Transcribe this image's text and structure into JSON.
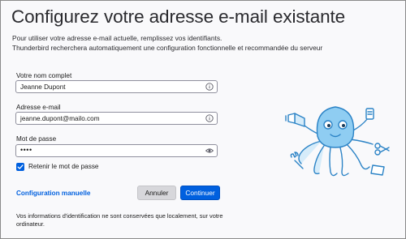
{
  "page": {
    "title": "Configurez votre adresse e-mail existante",
    "intro_line_1": "Pour utiliser votre adresse e-mail actuelle, remplissez vos identifiants.",
    "intro_line_2": "Thunderbird recherchera automatiquement une configuration fonctionnelle et recommandée du serveur"
  },
  "form": {
    "name": {
      "label": "Votre nom complet",
      "value": "Jeanne Dupont",
      "icon": "info-icon"
    },
    "email": {
      "label": "Adresse e-mail",
      "value": "jeanne.dupont@mailo.com",
      "icon": "info-icon"
    },
    "password": {
      "label": "Mot de passe",
      "masked_value": "••••",
      "icon": "eye-icon"
    },
    "remember": {
      "label": "Retenir le mot de passe",
      "checked": true
    }
  },
  "actions": {
    "manual_config": "Configuration manuelle",
    "cancel": "Annuler",
    "continue": "Continuer"
  },
  "footer": {
    "privacy_note": "Vos informations d'identification ne sont conservées que localement, sur votre ordinateur."
  },
  "colors": {
    "accent": "#0060df",
    "mascot": "#4aa8e0"
  }
}
